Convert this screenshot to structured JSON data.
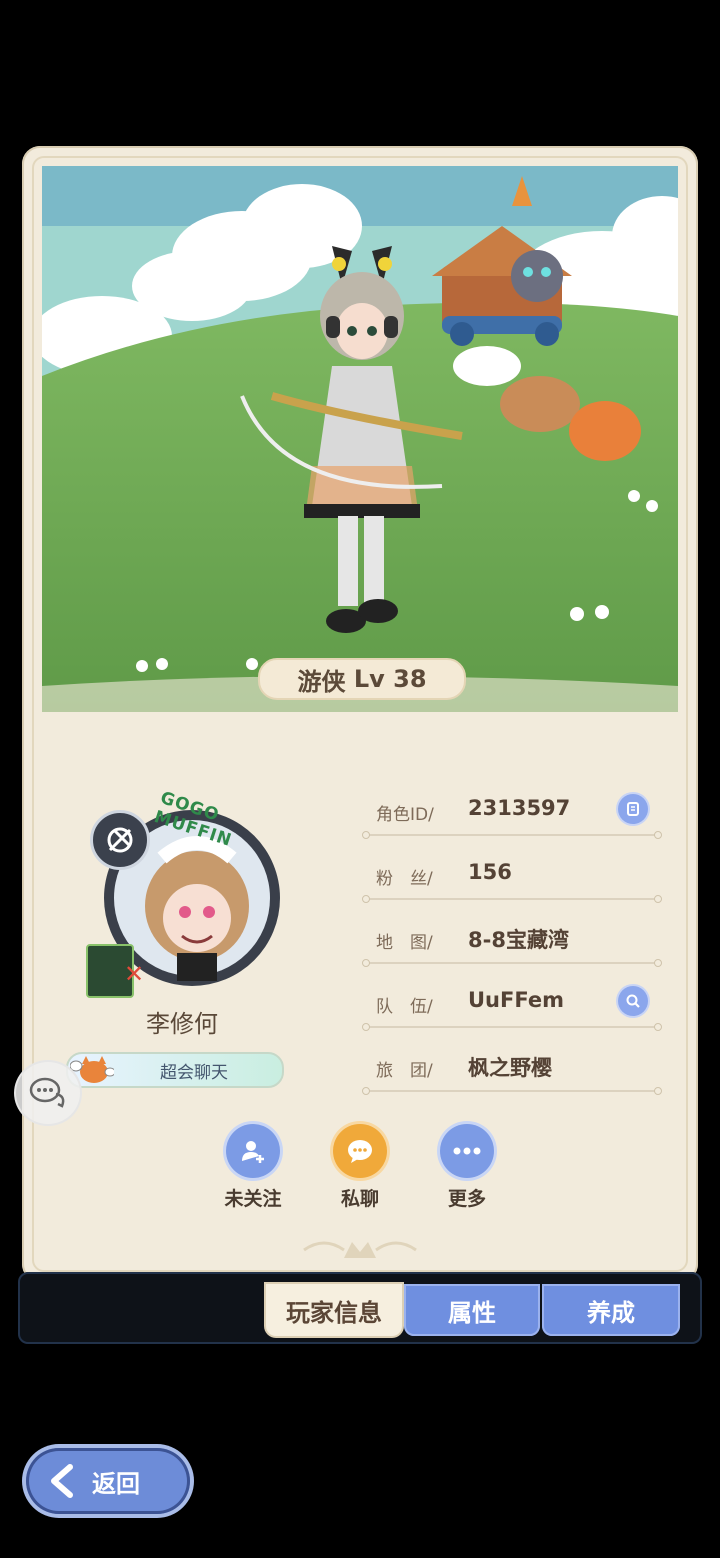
{
  "character": {
    "class_label": "游侠",
    "level_prefix": "Lv",
    "level": "38"
  },
  "avatar": {
    "frame_text": "GOGO MUFFIN"
  },
  "player": {
    "name": "李修何",
    "title_badge": "超会聊天"
  },
  "info_rows": [
    {
      "label": "角色ID/",
      "value": "2313597",
      "icon": "copy-icon"
    },
    {
      "label": "粉　丝/",
      "value": "156"
    },
    {
      "label": "地　图/",
      "value": "8-8宝藏湾"
    },
    {
      "label": "队　伍/",
      "value": "UuFFem",
      "icon": "search-icon"
    },
    {
      "label": "旅　团/",
      "value": "枫之野樱"
    }
  ],
  "actions": [
    {
      "label": "未关注",
      "icon": "add-user-icon",
      "color": "#7c9be5"
    },
    {
      "label": "私聊",
      "icon": "chat-bubble-icon",
      "color": "#f0a93a"
    },
    {
      "label": "更多",
      "icon": "more-dots-icon",
      "color": "#7c9be5"
    }
  ],
  "tabs": [
    {
      "label": "玩家信息",
      "active": true
    },
    {
      "label": "属性",
      "active": false
    },
    {
      "label": "养成",
      "active": false
    }
  ],
  "back_button": {
    "label": "返回"
  },
  "colors": {
    "card_bg": "#f2ebdc",
    "accent_blue": "#7c9be5",
    "accent_orange": "#f0a93a",
    "tab_active_bg": "#f6efdf",
    "tab_inactive_bg": "#6f8fe0"
  }
}
